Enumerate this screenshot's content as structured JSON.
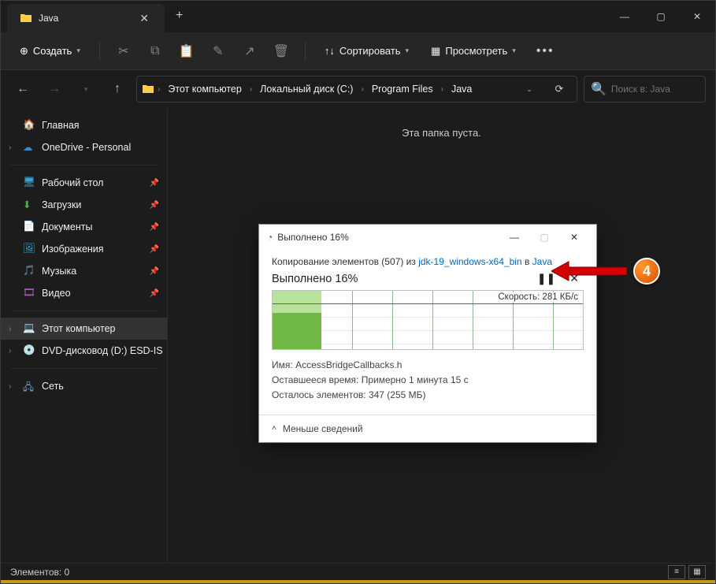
{
  "tab": {
    "title": "Java"
  },
  "toolbar": {
    "create": "Создать",
    "sort": "Сортировать",
    "view": "Просмотреть"
  },
  "breadcrumb": [
    "Этот компьютер",
    "Локальный диск (C:)",
    "Program Files",
    "Java"
  ],
  "search": {
    "placeholder": "Поиск в: Java"
  },
  "sidebar": {
    "home": "Главная",
    "onedrive": "OneDrive - Personal",
    "desktop": "Рабочий стол",
    "downloads": "Загрузки",
    "documents": "Документы",
    "pictures": "Изображения",
    "music": "Музыка",
    "videos": "Видео",
    "thispc": "Этот компьютер",
    "dvd": "DVD-дисковод (D:) ESD-IS",
    "network": "Сеть"
  },
  "content": {
    "empty": "Эта папка пуста."
  },
  "status": {
    "count": "Элементов: 0"
  },
  "dialog": {
    "title": "Выполнено 16%",
    "copying_prefix": "Копирование элементов (507) из ",
    "source": "jdk-19_windows-x64_bin",
    "in": " в ",
    "dest": "Java",
    "progress": "Выполнено 16%",
    "speed": "Скорость: 281 КБ/с",
    "name_label": "Имя:",
    "name_value": "AccessBridgeCallbacks.h",
    "time_label": "Оставшееся время:",
    "time_value": "Примерно 1 минута 15 с",
    "remain_label": "Осталось элементов:",
    "remain_value": "347 (255 МБ)",
    "less": "Меньше сведений"
  },
  "callout": {
    "num": "4"
  }
}
